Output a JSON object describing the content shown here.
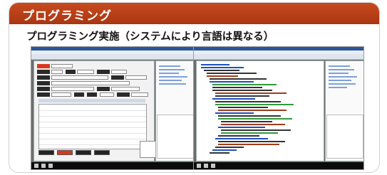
{
  "slide": {
    "title": "プログラミング",
    "subtitle": "プログラミング実施（システムにより言語は異なる）"
  },
  "colors": {
    "header": "#b83d15",
    "code_keyword": "#1f4fbf",
    "code_comment": "#2e9a3a",
    "code_string": "#a33a1a",
    "accent_red": "#d9381e"
  },
  "screenshots": [
    {
      "kind": "form-designer",
      "icon": "form-window-icon"
    },
    {
      "kind": "code-editor",
      "icon": "code-window-icon"
    }
  ]
}
